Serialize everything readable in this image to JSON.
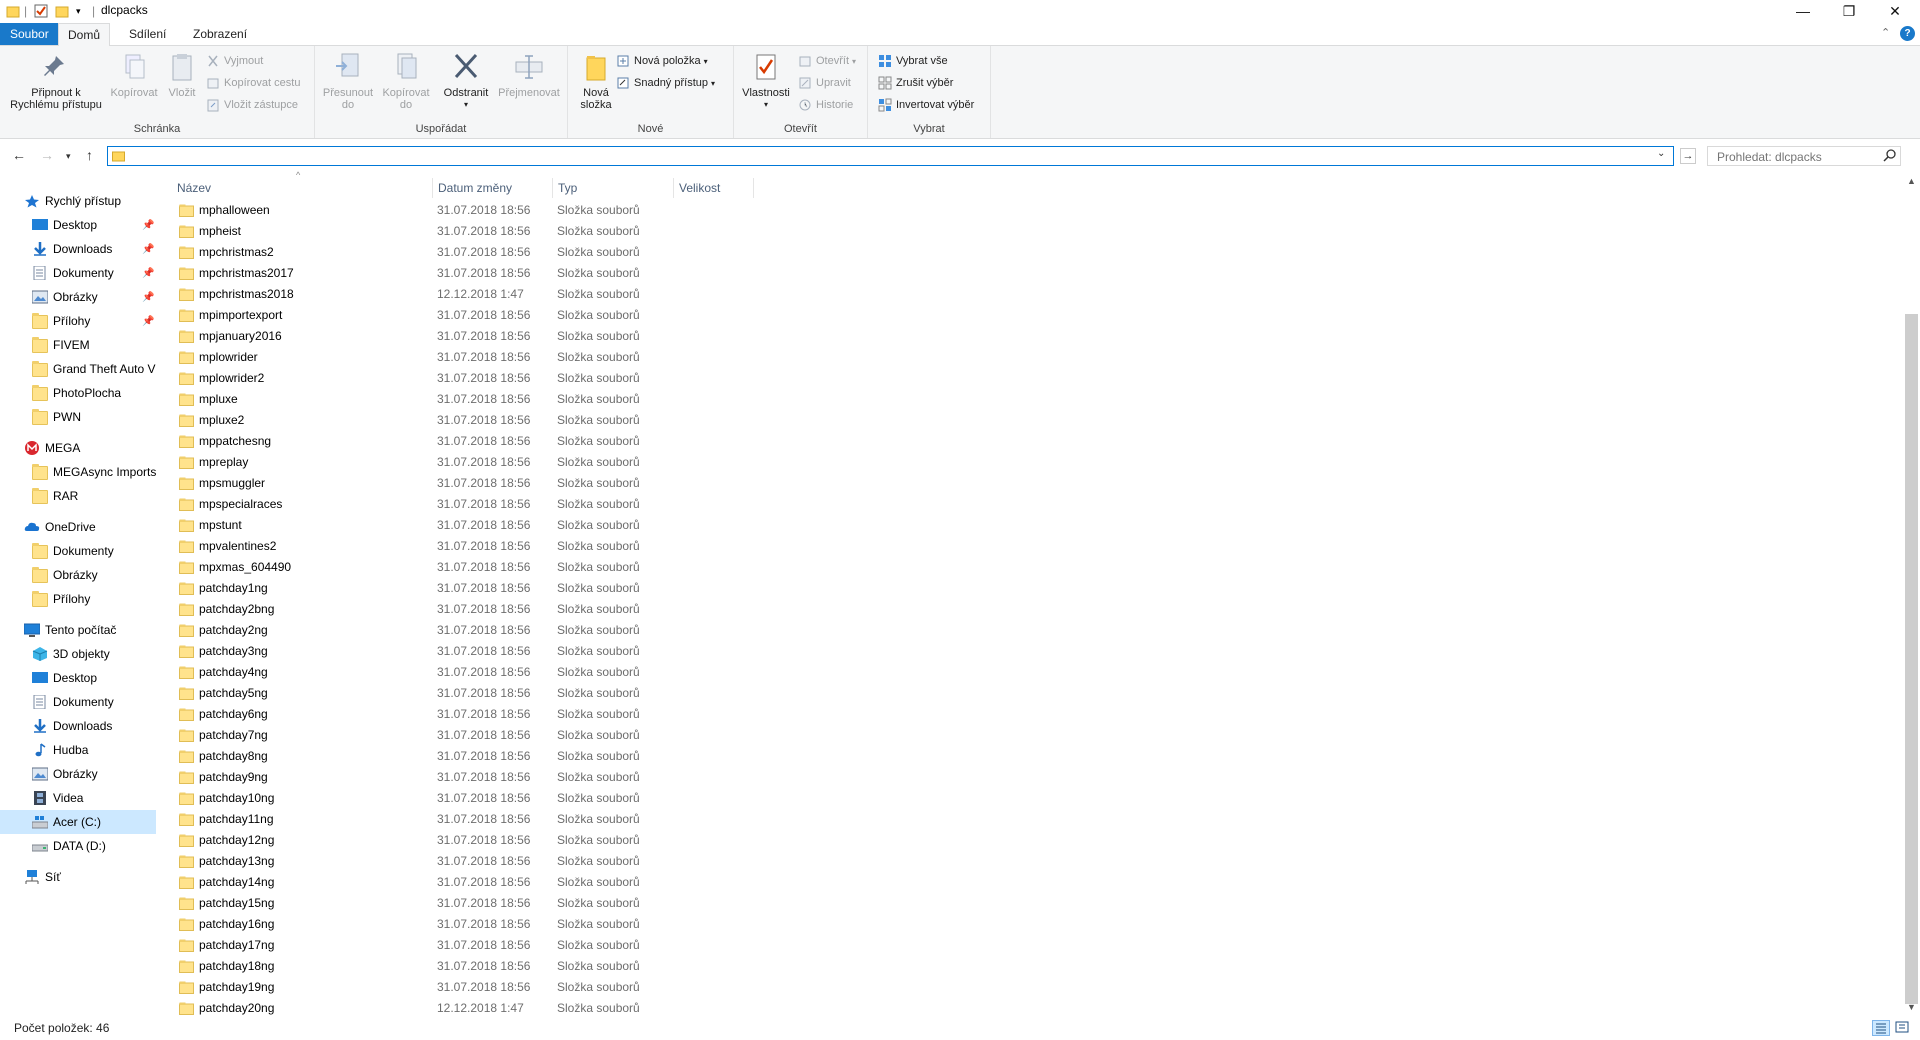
{
  "window": {
    "title": "dlcpacks",
    "minimize_glyph": "—",
    "maximize_glyph": "❐",
    "close_glyph": "✕",
    "help_glyph": "?",
    "collapse_glyph": "⌃"
  },
  "tabs": [
    {
      "label": "Soubor"
    },
    {
      "label": "Domů"
    },
    {
      "label": "Sdílení"
    },
    {
      "label": "Zobrazení"
    }
  ],
  "ribbon": {
    "schranka": {
      "label": "Schránka",
      "pin_line1": "Připnout k",
      "pin_line2": "Rychlému přístupu",
      "copy": "Kopírovat",
      "paste": "Vložit",
      "cut": "Vyjmout",
      "copy_path": "Kopírovat cestu",
      "paste_shortcut": "Vložit zástupce"
    },
    "usporadat": {
      "label": "Uspořádat",
      "move_line1": "Přesunout",
      "move_line2": "do",
      "copyto_line1": "Kopírovat",
      "copyto_line2": "do",
      "delete": "Odstranit",
      "rename": "Přejmenovat"
    },
    "nove": {
      "label": "Nové",
      "new_folder_line1": "Nová",
      "new_folder_line2": "složka",
      "new_item": "Nová položka",
      "easy_access": "Snadný přístup"
    },
    "otevrit": {
      "label": "Otevřít",
      "properties": "Vlastnosti",
      "open": "Otevřít",
      "edit": "Upravit",
      "history": "Historie"
    },
    "vybrat": {
      "label": "Vybrat",
      "select_all": "Vybrat vše",
      "select_none": "Zrušit výběr",
      "invert": "Invertovat výběr"
    }
  },
  "address": {
    "value": "",
    "search_placeholder": "Prohledat: dlcpacks"
  },
  "navpane": {
    "quick_access": "Rychlý přístup",
    "quick_items": [
      "Desktop",
      "Downloads",
      "Dokumenty",
      "Obrázky",
      "Přílohy",
      "FIVEM",
      "Grand Theft Auto V",
      "PhotoPlocha",
      "PWN"
    ],
    "mega": "MEGA",
    "mega_items": [
      "MEGAsync Imports",
      "RAR"
    ],
    "onedrive": "OneDrive",
    "onedrive_items": [
      "Dokumenty",
      "Obrázky",
      "Přílohy"
    ],
    "this_pc": "Tento počítač",
    "pc_items": [
      "3D objekty",
      "Desktop",
      "Dokumenty",
      "Downloads",
      "Hudba",
      "Obrázky",
      "Videa",
      "Acer (C:)",
      "DATA (D:)"
    ],
    "network": "Síť"
  },
  "columns": {
    "name": "Název",
    "date": "Datum změny",
    "type": "Typ",
    "size": "Velikost"
  },
  "files": [
    {
      "name": "mphalloween",
      "date": "31.07.2018 18:56",
      "type": "Složka souborů"
    },
    {
      "name": "mpheist",
      "date": "31.07.2018 18:56",
      "type": "Složka souborů"
    },
    {
      "name": "mpchristmas2",
      "date": "31.07.2018 18:56",
      "type": "Složka souborů"
    },
    {
      "name": "mpchristmas2017",
      "date": "31.07.2018 18:56",
      "type": "Složka souborů"
    },
    {
      "name": "mpchristmas2018",
      "date": "12.12.2018 1:47",
      "type": "Složka souborů"
    },
    {
      "name": "mpimportexport",
      "date": "31.07.2018 18:56",
      "type": "Složka souborů"
    },
    {
      "name": "mpjanuary2016",
      "date": "31.07.2018 18:56",
      "type": "Složka souborů"
    },
    {
      "name": "mplowrider",
      "date": "31.07.2018 18:56",
      "type": "Složka souborů"
    },
    {
      "name": "mplowrider2",
      "date": "31.07.2018 18:56",
      "type": "Složka souborů"
    },
    {
      "name": "mpluxe",
      "date": "31.07.2018 18:56",
      "type": "Složka souborů"
    },
    {
      "name": "mpluxe2",
      "date": "31.07.2018 18:56",
      "type": "Složka souborů"
    },
    {
      "name": "mppatchesng",
      "date": "31.07.2018 18:56",
      "type": "Složka souborů"
    },
    {
      "name": "mpreplay",
      "date": "31.07.2018 18:56",
      "type": "Složka souborů"
    },
    {
      "name": "mpsmuggler",
      "date": "31.07.2018 18:56",
      "type": "Složka souborů"
    },
    {
      "name": "mpspecialraces",
      "date": "31.07.2018 18:56",
      "type": "Složka souborů"
    },
    {
      "name": "mpstunt",
      "date": "31.07.2018 18:56",
      "type": "Složka souborů"
    },
    {
      "name": "mpvalentines2",
      "date": "31.07.2018 18:56",
      "type": "Složka souborů"
    },
    {
      "name": "mpxmas_604490",
      "date": "31.07.2018 18:56",
      "type": "Složka souborů"
    },
    {
      "name": "patchday1ng",
      "date": "31.07.2018 18:56",
      "type": "Složka souborů"
    },
    {
      "name": "patchday2bng",
      "date": "31.07.2018 18:56",
      "type": "Složka souborů"
    },
    {
      "name": "patchday2ng",
      "date": "31.07.2018 18:56",
      "type": "Složka souborů"
    },
    {
      "name": "patchday3ng",
      "date": "31.07.2018 18:56",
      "type": "Složka souborů"
    },
    {
      "name": "patchday4ng",
      "date": "31.07.2018 18:56",
      "type": "Složka souborů"
    },
    {
      "name": "patchday5ng",
      "date": "31.07.2018 18:56",
      "type": "Složka souborů"
    },
    {
      "name": "patchday6ng",
      "date": "31.07.2018 18:56",
      "type": "Složka souborů"
    },
    {
      "name": "patchday7ng",
      "date": "31.07.2018 18:56",
      "type": "Složka souborů"
    },
    {
      "name": "patchday8ng",
      "date": "31.07.2018 18:56",
      "type": "Složka souborů"
    },
    {
      "name": "patchday9ng",
      "date": "31.07.2018 18:56",
      "type": "Složka souborů"
    },
    {
      "name": "patchday10ng",
      "date": "31.07.2018 18:56",
      "type": "Složka souborů"
    },
    {
      "name": "patchday11ng",
      "date": "31.07.2018 18:56",
      "type": "Složka souborů"
    },
    {
      "name": "patchday12ng",
      "date": "31.07.2018 18:56",
      "type": "Složka souborů"
    },
    {
      "name": "patchday13ng",
      "date": "31.07.2018 18:56",
      "type": "Složka souborů"
    },
    {
      "name": "patchday14ng",
      "date": "31.07.2018 18:56",
      "type": "Složka souborů"
    },
    {
      "name": "patchday15ng",
      "date": "31.07.2018 18:56",
      "type": "Složka souborů"
    },
    {
      "name": "patchday16ng",
      "date": "31.07.2018 18:56",
      "type": "Složka souborů"
    },
    {
      "name": "patchday17ng",
      "date": "31.07.2018 18:56",
      "type": "Složka souborů"
    },
    {
      "name": "patchday18ng",
      "date": "31.07.2018 18:56",
      "type": "Složka souborů"
    },
    {
      "name": "patchday19ng",
      "date": "31.07.2018 18:56",
      "type": "Složka souborů"
    },
    {
      "name": "patchday20ng",
      "date": "12.12.2018 1:47",
      "type": "Složka souborů"
    }
  ],
  "status": {
    "count": "Počet položek: 46"
  },
  "colors": {
    "accent": "#0078d7",
    "file_tab": "#1979ca",
    "folder": "#ffe38c",
    "selected": "#cce8ff"
  }
}
